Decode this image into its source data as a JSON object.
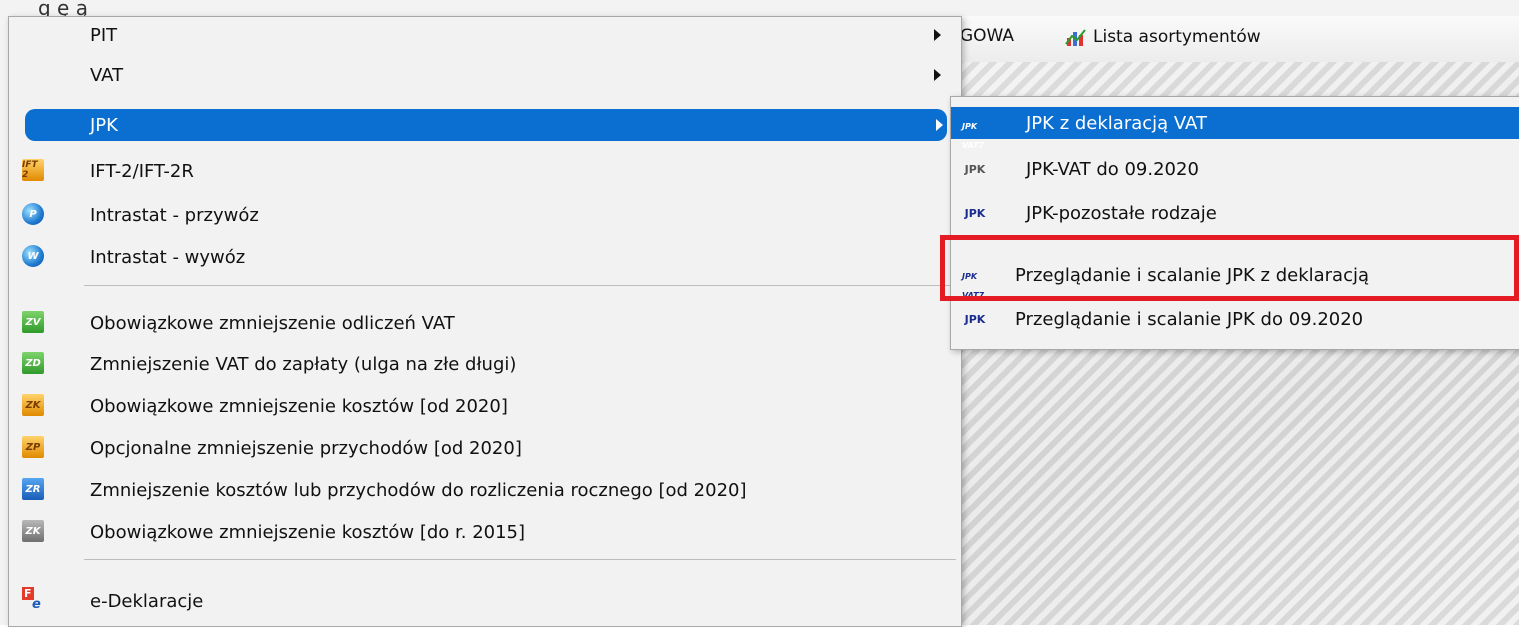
{
  "top_caption": "g ę            ą",
  "toolbar": {
    "item1": "GOWA",
    "item2": "Lista asortymentów"
  },
  "menu": {
    "items": [
      {
        "label": "PIT",
        "has_submenu": true
      },
      {
        "label": "VAT",
        "has_submenu": true
      },
      {
        "label": "JPK",
        "has_submenu": true,
        "active": true
      },
      {
        "label": "IFT-2/IFT-2R",
        "icon": "ift-icon"
      },
      {
        "label": "Intrastat - przywóz",
        "icon": "intrastat-import-icon"
      },
      {
        "label": "Intrastat - wywóz",
        "icon": "intrastat-export-icon"
      },
      {
        "label": "Obowiązkowe zmniejszenie odliczeń VAT",
        "icon": "zv-icon"
      },
      {
        "label": "Zmniejszenie VAT do zapłaty (ulga na złe długi)",
        "icon": "zd-icon"
      },
      {
        "label": "Obowiązkowe zmniejszenie kosztów [od 2020]",
        "icon": "zk-icon"
      },
      {
        "label": "Opcjonalne zmniejszenie przychodów [od 2020]",
        "icon": "zp-icon"
      },
      {
        "label": "Zmniejszenie kosztów lub przychodów do rozliczenia rocznego [od 2020]",
        "icon": "zr-icon"
      },
      {
        "label": "Obowiązkowe zmniejszenie kosztów [do r. 2015]",
        "icon": "zk-old-icon"
      },
      {
        "label": "e-Deklaracje",
        "icon": "e-declaration-icon"
      }
    ]
  },
  "submenu": {
    "items": [
      {
        "label": "JPK z deklaracją VAT",
        "icon_text": "JPK VAT7",
        "active": true
      },
      {
        "label": "JPK-VAT do 09.2020",
        "icon_text": "JPK"
      },
      {
        "label": "JPK-pozostałe rodzaje",
        "icon_text": "JPK"
      },
      {
        "label": "Przeglądanie i scalanie JPK z deklaracją",
        "icon_text": "JPK VAT7",
        "highlighted": true
      },
      {
        "label": "Przeglądanie i scalanie JPK do 09.2020",
        "icon_text": "JPK"
      }
    ]
  },
  "icons": {
    "ift": "IFT 2",
    "intrastat_import": "P",
    "intrastat_export": "W",
    "zv": "ZV",
    "zd": "ZD",
    "zk": "ZK",
    "zp": "ZP",
    "zr": "ZR",
    "zk_old": "ZK",
    "fe_f": "F",
    "fe_e": "e"
  },
  "colors": {
    "selection": "#0a6fd1",
    "highlight_border": "#e51b24"
  }
}
